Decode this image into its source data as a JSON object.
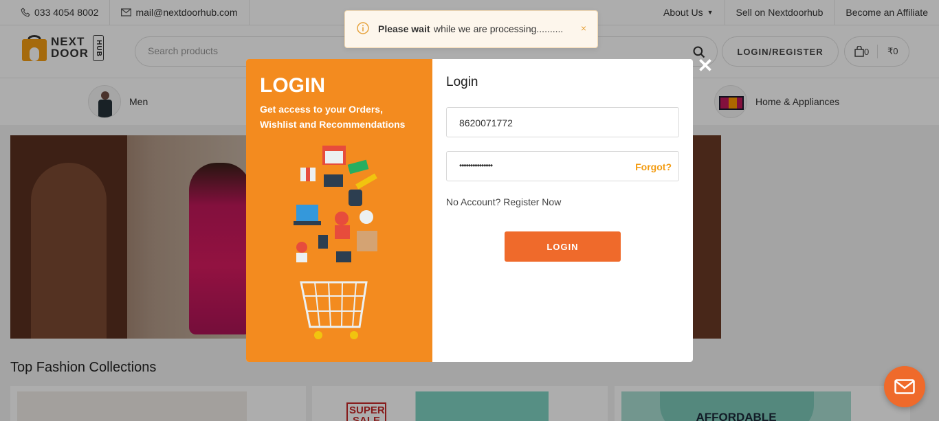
{
  "topbar": {
    "phone": "033 4054 8002",
    "email": "mail@nextdoorhub.com",
    "about": "About Us",
    "sell": "Sell on Nextdoorhub",
    "affiliate": "Become an Affiliate"
  },
  "header": {
    "logo_line1": "NEXT",
    "logo_line2": "DOOR",
    "logo_hub": "HUB",
    "search_placeholder": "Search products",
    "login_register": "LOGIN/REGISTER",
    "cart_count": "0",
    "cart_total": "₹0"
  },
  "categories": [
    {
      "label": "Men"
    },
    {
      "label": "Home & Appliances"
    }
  ],
  "section_title": "Top Fashion Collections",
  "cards": {
    "card2_badge": "SUPER SALE",
    "card3_text": "AFFORDABLE"
  },
  "modal": {
    "left_title": "LOGIN",
    "left_text": "Get access to your Orders, Wishlist and Recommendations",
    "title": "Login",
    "phone_value": "8620071772",
    "password_value": "•••••••••••••••",
    "forgot": "Forgot?",
    "no_account": "No Account? Register Now",
    "login_button": "LOGIN",
    "close": "✕"
  },
  "toast": {
    "bold": "Please wait",
    "message": "while we are processing..........",
    "close": "×"
  },
  "colors": {
    "orange_panel": "#f38b1f",
    "login_button": "#ef6a2b",
    "forgot": "#f39c12"
  }
}
